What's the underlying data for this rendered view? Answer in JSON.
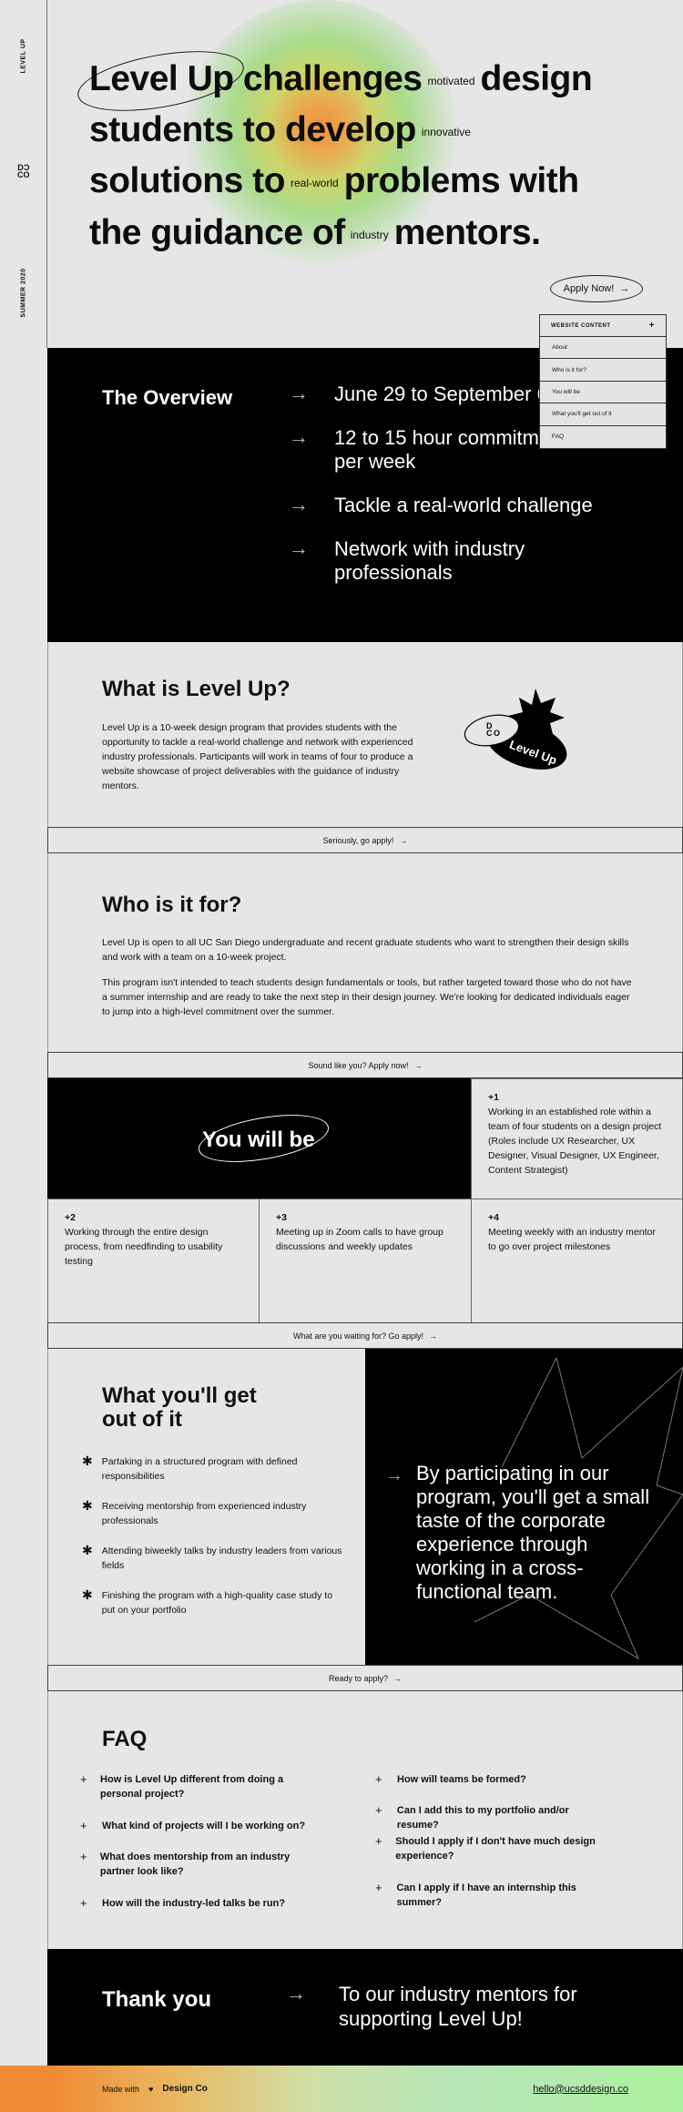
{
  "sidebar": {
    "top_label": "LEVEL UP",
    "logo": "D C\nC O",
    "bottom_label": "SUMMER 2020"
  },
  "hero": {
    "line1_a": "Level Up challenges",
    "line1_small": "motivated",
    "line1_b": "design",
    "line2_a": "students to develop",
    "line2_small": "innovative",
    "line3_a": "solutions to",
    "line3_small": "real-world",
    "line3_b": "problems with",
    "line4_a": "the guidance of",
    "line4_small": "industry",
    "line4_b": "mentors.",
    "apply_label": "Apply Now!"
  },
  "dropdown": {
    "header": "WEBSITE CONTENT",
    "items": [
      "About",
      "Who is it for?",
      "You will be",
      "What you'll get out of it",
      "FAQ"
    ]
  },
  "overview": {
    "title": "The Overview",
    "items": [
      "June 29 to September 6",
      "12 to 15 hour commitment per week",
      "Tackle a real-world challenge",
      "Network with industry professionals"
    ]
  },
  "whatis": {
    "title": "What is Level Up?",
    "body": "Level Up is a 10-week design program that provides students with the opportunity to tackle a real-world challenge and network with experienced industry professionals. Participants will work in teams of four to produce a website showcase of project deliverables with the guidance of industry mentors.",
    "sticker_text": "Level Up"
  },
  "cta": {
    "bar1": "Seriously, go apply!",
    "bar2": "Sound like you? Apply now!",
    "bar3": "What are you waiting for? Go apply!",
    "bar4": "Ready to apply?"
  },
  "who": {
    "title": "Who is it for?",
    "p1": "Level Up is open to all UC San Diego undergraduate and recent graduate students who want to strengthen their design skills and work with a team on a 10-week project.",
    "p2": "This program isn't intended to teach students design fundamentals or tools, but rather targeted toward those who do not have a summer internship and are ready to take the next step in their design journey. We're looking for dedicated individuals eager to jump into a high-level commitment over the summer."
  },
  "youwillbe": {
    "title": "You will be",
    "items": [
      {
        "num": "+1",
        "text": "Working in an established role within a team of four students on a design project (Roles include UX Researcher, UX Designer, Visual Designer, UX Engineer, Content Strategist)"
      },
      {
        "num": "+2",
        "text": "Working through the entire design process, from needfinding to usability testing"
      },
      {
        "num": "+3",
        "text": "Meeting up in Zoom calls to have group discussions and weekly updates"
      },
      {
        "num": "+4",
        "text": "Meeting weekly with an industry mentor to go over project milestones"
      }
    ]
  },
  "get": {
    "title": "What you'll get out of it",
    "items": [
      "Partaking in a structured program with defined responsibilities",
      "Receiving mentorship from experienced industry professionals",
      "Attending biweekly talks by industry leaders from various fields",
      "Finishing the program with a high-quality case study to put on your portfolio"
    ],
    "quote": "By participating in our program, you'll get a small taste of the corporate experience through working in a cross-functional team."
  },
  "faq": {
    "title": "FAQ",
    "left": [
      "How is Level Up different from doing a personal project?",
      "What kind of projects will I be working on?",
      "What does mentorship from an industry partner look like?",
      "How will the industry-led talks be run?"
    ],
    "right": [
      "How will teams be formed?",
      "Can I add this to my portfolio and/or resume?",
      "Should I apply if I don't have much design experience?",
      "Can I apply if I have an internship this summer?"
    ]
  },
  "thanks": {
    "title": "Thank you",
    "message": "To our industry mentors for supporting Level Up!"
  },
  "footer": {
    "made_with": "Made with",
    "brand": "Design Co",
    "email": "hello@ucsddesign.co"
  }
}
